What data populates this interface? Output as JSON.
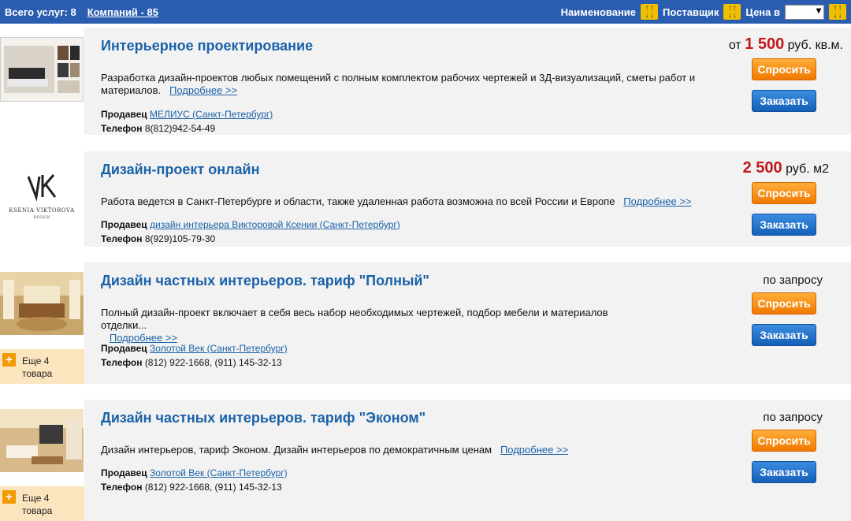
{
  "topbar": {
    "services_total": "Всего услуг: 8",
    "companies_link": "Компаний - 85",
    "sort_name": "Наименование",
    "sort_supplier": "Поставщик",
    "sort_price": "Цена в"
  },
  "items": [
    {
      "title": "Интерьерное проектирование",
      "price_prefix": "от",
      "price_value": "1 500",
      "price_unit": "руб. кв.м.",
      "description": "Разработка дизайн-проектов любых помещений с полным комплектом рабочих чертежей и 3Д-визуализаций, сметы работ и материалов.",
      "more_link": "Подробнее >>",
      "seller_label": "Продавец",
      "seller_name": "МЕЛИУС (Санкт-Петербург)",
      "phone_label": "Телефон",
      "phone": "8(812)942-54-49",
      "ask": "Спросить",
      "order": "Заказать"
    },
    {
      "title": "Дизайн-проект онлайн",
      "price_value": "2 500",
      "price_unit": "руб. м2",
      "description": "Работа ведется в Санкт-Петербурге и области, также удаленная работа возможна по всей России и Европе",
      "more_link": "Подробнее >>",
      "seller_label": "Продавец",
      "seller_name": "дизайн интерьера Викторовой Ксении (Санкт-Петербург)",
      "phone_label": "Телефон",
      "phone": "8(929)105-79-30",
      "ask": "Спросить",
      "order": "Заказать",
      "logo_text": "KSENIA VIKTOROVA",
      "logo_sub": "DESIGN"
    },
    {
      "title": "Дизайн частных интерьеров. тариф \"Полный\"",
      "price_text": "по запросу",
      "description": "Полный дизайн-проект включает в себя весь набор необходимых чертежей, подбор мебели и материалов отделки...",
      "more_link": "Подробнее >>",
      "seller_label": "Продавец",
      "seller_name": "Золотой Век (Санкт-Петербург)",
      "phone_label": "Телефон",
      "phone": "(812) 922-1668, (911) 145-32-13",
      "ask": "Спросить",
      "order": "Заказать",
      "more_goods": "Еще 4 товара"
    },
    {
      "title": "Дизайн частных интерьеров. тариф \"Эконом\"",
      "price_text": "по запросу",
      "description": "Дизайн интерьеров, тариф Эконом. Дизайн интерьеров по демократичным ценам",
      "more_link": "Подробнее >>",
      "seller_label": "Продавец",
      "seller_name": "Золотой Век (Санкт-Петербург)",
      "phone_label": "Телефон",
      "phone": "(812) 922-1668, (911) 145-32-13",
      "ask": "Спросить",
      "order": "Заказать",
      "more_goods": "Еще 4 товара"
    }
  ]
}
